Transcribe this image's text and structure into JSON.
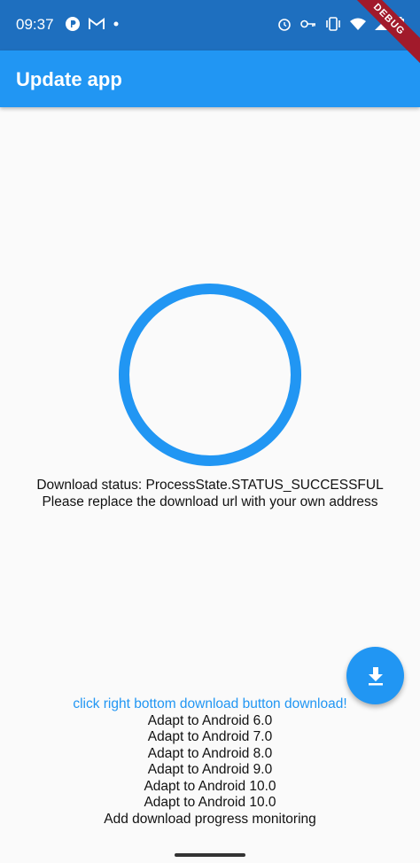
{
  "status_bar": {
    "time": "09:37",
    "left_icons": [
      "p-app-icon",
      "gmail-icon",
      "dot-icon"
    ],
    "right_icons": [
      "alarm-icon",
      "key-icon",
      "vibrate-icon",
      "wifi-icon",
      "signal-icon",
      "battery-icon"
    ]
  },
  "debug_banner": "DEBUG",
  "app_bar": {
    "title": "Update app"
  },
  "progress": {
    "value": 1.0,
    "color": "#2196f3"
  },
  "status": {
    "line1": "Download status: ProcessState.STATUS_SUCCESSFUL",
    "line2": "Please replace the download url with your own address"
  },
  "fab": {
    "icon": "download-icon"
  },
  "changelog": {
    "link": "click right bottom download button download!",
    "items": [
      "Adapt to Android 6.0",
      "Adapt to Android 7.0",
      "Adapt to Android 8.0",
      "Adapt to Android 9.0",
      "Adapt to Android 10.0",
      "Adapt to Android 10.0",
      "Add download progress monitoring"
    ]
  },
  "colors": {
    "primary": "#2196f3",
    "status_bar": "#1e6fbf",
    "background": "#fafafa"
  }
}
